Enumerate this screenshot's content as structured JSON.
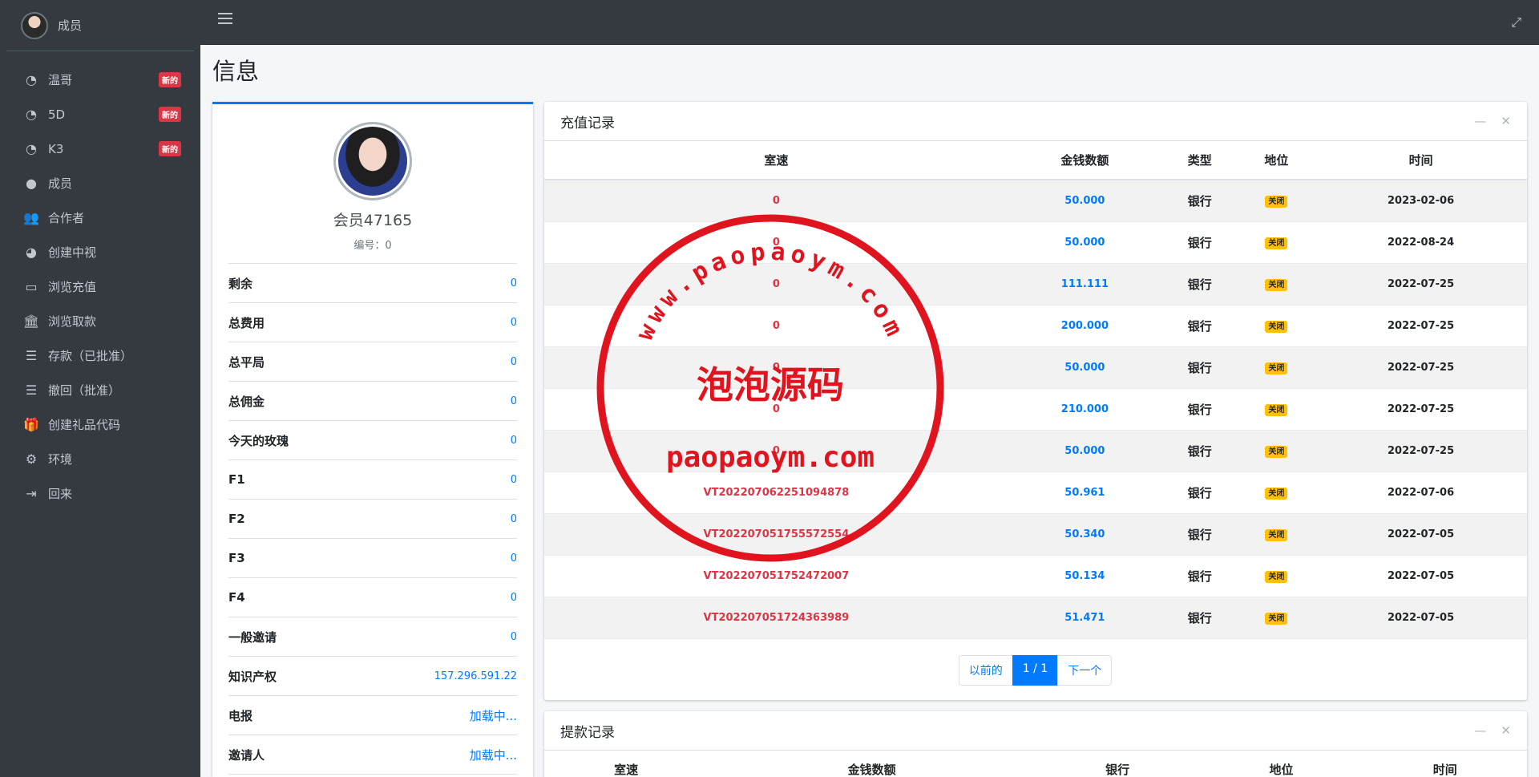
{
  "user": {
    "name": "成员"
  },
  "sidebar": {
    "items": [
      {
        "label": "温哥",
        "icon": "gauge-icon",
        "badge": "新的"
      },
      {
        "label": "5D",
        "icon": "gauge-icon",
        "badge": "新的"
      },
      {
        "label": "K3",
        "icon": "gauge-icon",
        "badge": "新的"
      },
      {
        "label": "成员",
        "icon": "user-circle-icon",
        "badge": ""
      },
      {
        "label": "合作者",
        "icon": "users-icon",
        "badge": ""
      },
      {
        "label": "创建中视",
        "icon": "pie-chart-icon",
        "badge": ""
      },
      {
        "label": "浏览充值",
        "icon": "credit-card-icon",
        "badge": ""
      },
      {
        "label": "浏览取款",
        "icon": "bank-icon",
        "badge": ""
      },
      {
        "label": "存款（已批准）",
        "icon": "list-icon",
        "badge": ""
      },
      {
        "label": "撤回（批准）",
        "icon": "list-icon",
        "badge": ""
      },
      {
        "label": "创建礼品代码",
        "icon": "gift-icon",
        "badge": ""
      },
      {
        "label": "环境",
        "icon": "gear-icon",
        "badge": ""
      },
      {
        "label": "回来",
        "icon": "sign-out-icon",
        "badge": ""
      }
    ]
  },
  "page": {
    "title": "信息"
  },
  "profile": {
    "name": "会员47165",
    "id_label": "编号：",
    "id_value": "0",
    "rows": [
      {
        "key": "剩余",
        "value": "0"
      },
      {
        "key": "总费用",
        "value": "0"
      },
      {
        "key": "总平局",
        "value": "0"
      },
      {
        "key": "总佣金",
        "value": "0"
      },
      {
        "key": "今天的玫瑰",
        "value": "0"
      },
      {
        "key": "F1",
        "value": "0"
      },
      {
        "key": "F2",
        "value": "0"
      },
      {
        "key": "F3",
        "value": "0"
      },
      {
        "key": "F4",
        "value": "0"
      },
      {
        "key": "一般邀请",
        "value": "0"
      },
      {
        "key": "知识产权",
        "value": "157.296.591.22"
      },
      {
        "key": "电报",
        "value": "加载中..."
      },
      {
        "key": "邀请人",
        "value": "加载中..."
      }
    ]
  },
  "recharge": {
    "title": "充值记录",
    "columns": [
      "室速",
      "金钱数额",
      "类型",
      "地位",
      "时间"
    ],
    "rows": [
      {
        "id": "0",
        "amount": "50.000",
        "type": "银行",
        "status": "关闭",
        "date": "2023-02-06"
      },
      {
        "id": "0",
        "amount": "50.000",
        "type": "银行",
        "status": "关闭",
        "date": "2022-08-24"
      },
      {
        "id": "0",
        "amount": "111.111",
        "type": "银行",
        "status": "关闭",
        "date": "2022-07-25"
      },
      {
        "id": "0",
        "amount": "200.000",
        "type": "银行",
        "status": "关闭",
        "date": "2022-07-25"
      },
      {
        "id": "0",
        "amount": "50.000",
        "type": "银行",
        "status": "关闭",
        "date": "2022-07-25"
      },
      {
        "id": "0",
        "amount": "210.000",
        "type": "银行",
        "status": "关闭",
        "date": "2022-07-25"
      },
      {
        "id": "0",
        "amount": "50.000",
        "type": "银行",
        "status": "关闭",
        "date": "2022-07-25"
      },
      {
        "id": "VT202207062251094878",
        "amount": "50.961",
        "type": "银行",
        "status": "关闭",
        "date": "2022-07-06"
      },
      {
        "id": "VT202207051755572554",
        "amount": "50.340",
        "type": "银行",
        "status": "关闭",
        "date": "2022-07-05"
      },
      {
        "id": "VT202207051752472007",
        "amount": "50.134",
        "type": "银行",
        "status": "关闭",
        "date": "2022-07-05"
      },
      {
        "id": "VT202207051724363989",
        "amount": "51.471",
        "type": "银行",
        "status": "关闭",
        "date": "2022-07-05"
      }
    ],
    "pager": {
      "prev": "以前的",
      "current": "1 / 1",
      "next": "下一个"
    }
  },
  "withdraw": {
    "title": "提款记录",
    "columns": [
      "室速",
      "金钱数额",
      "银行",
      "地位",
      "时间"
    ]
  },
  "watermark": {
    "arc_text": "www.paopaoym.com",
    "center_text": "泡泡源码",
    "bottom_text": "paopaoym.com",
    "color": "#e0141e"
  },
  "colors": {
    "primary": "#007bff",
    "danger": "#dc3545",
    "warning": "#ffc107",
    "sidebar": "#343a40"
  }
}
